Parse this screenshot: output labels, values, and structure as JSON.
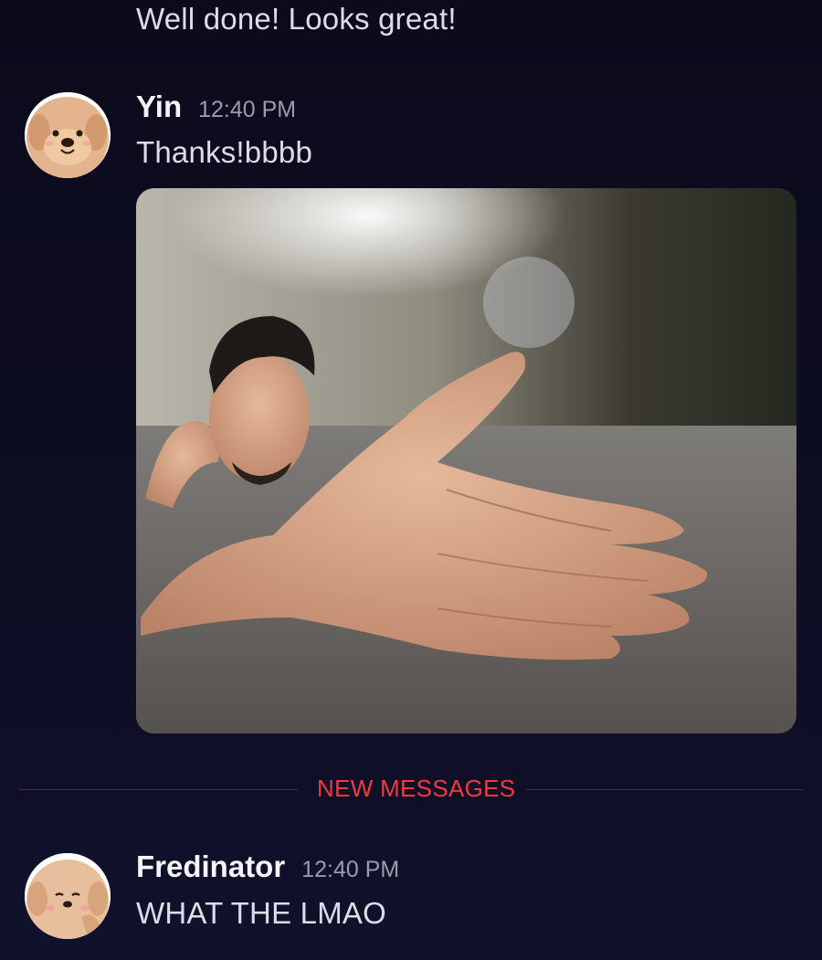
{
  "messages": {
    "previous": {
      "text": "Well done! Looks great!"
    },
    "yin": {
      "username": "Yin",
      "timestamp": "12:40 PM",
      "text": "Thanks!bbbb",
      "avatar_icon": "dog-avatar-icon",
      "attachment": "meme image: man lying on road with a giant hand for a body"
    },
    "divider": {
      "label": "NEW MESSAGES",
      "color": "#f2393f"
    },
    "fredinator": {
      "username": "Fredinator",
      "timestamp": "12:40 PM",
      "text": "WHAT THE LMAO",
      "avatar_icon": "dog-avatar-icon"
    }
  },
  "colors": {
    "background": "#0d0d22",
    "text": "#dcdde6",
    "timestamp": "#9a9bab",
    "new_messages": "#f2393f"
  }
}
